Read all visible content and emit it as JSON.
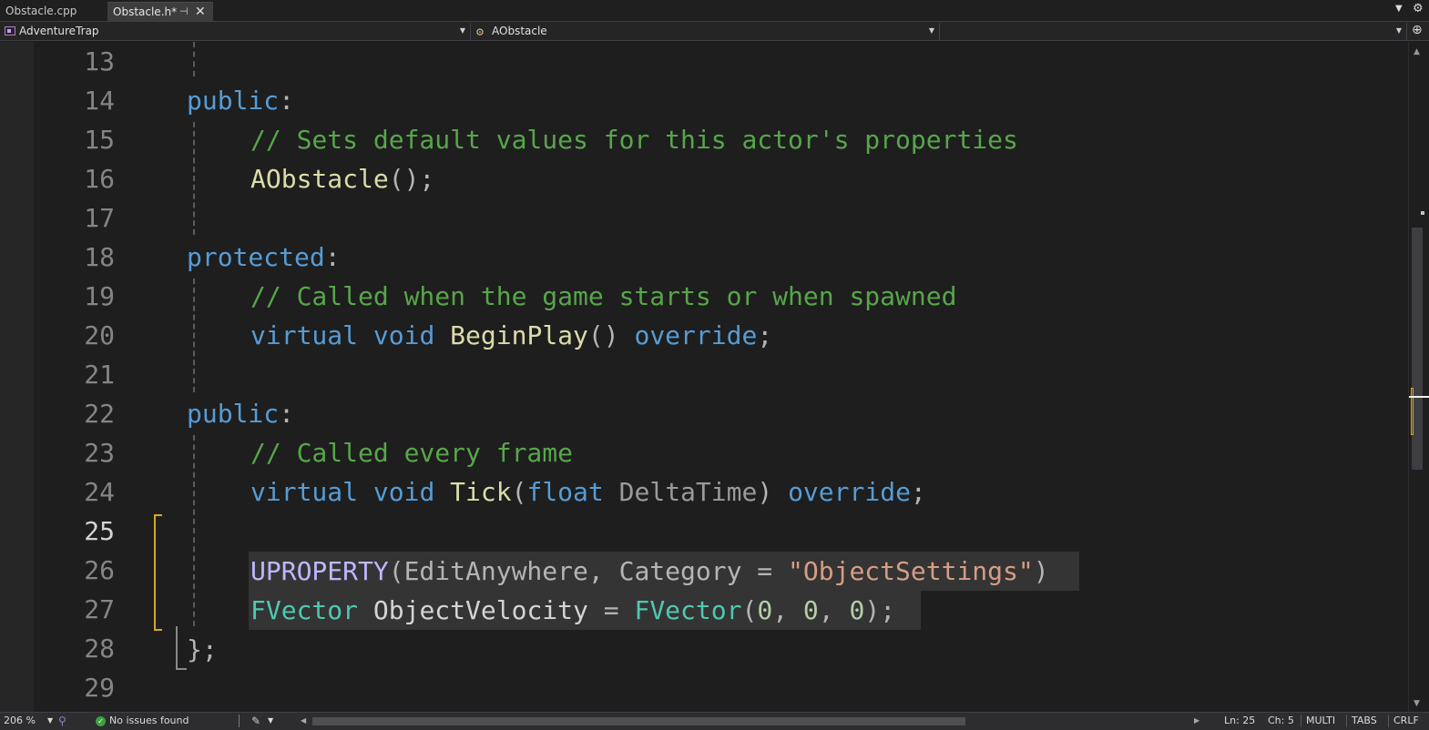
{
  "tabs": [
    {
      "label": "Obstacle.cpp",
      "active": false
    },
    {
      "label": "Obstacle.h*",
      "active": true,
      "pin_icon": "pin-icon",
      "close_icon": "close-icon"
    }
  ],
  "navbar": {
    "project": "AdventureTrap",
    "class_scope": "AObstacle",
    "member_scope": ""
  },
  "editor": {
    "current_line": 25,
    "lines": [
      {
        "num": "13",
        "text": ""
      },
      {
        "num": "14",
        "text": "public:"
      },
      {
        "num": "15",
        "text": "// Sets default values for this actor's properties"
      },
      {
        "num": "16",
        "text": "AObstacle();"
      },
      {
        "num": "17",
        "text": ""
      },
      {
        "num": "18",
        "text": "protected:"
      },
      {
        "num": "19",
        "text": "// Called when the game starts or when spawned"
      },
      {
        "num": "20",
        "text": "virtual void BeginPlay() override;"
      },
      {
        "num": "21",
        "text": ""
      },
      {
        "num": "22",
        "text": "public:"
      },
      {
        "num": "23",
        "text": "// Called every frame"
      },
      {
        "num": "24",
        "text": "virtual void Tick(float DeltaTime) override;"
      },
      {
        "num": "25",
        "text": ""
      },
      {
        "num": "26",
        "text": "UPROPERTY(EditAnywhere, Category = \"ObjectSettings\")"
      },
      {
        "num": "27",
        "text": "FVector ObjectVelocity = FVector(0, 0, 0);"
      },
      {
        "num": "28",
        "text": "};"
      },
      {
        "num": "29",
        "text": ""
      }
    ],
    "tokens": {
      "l14_kw": "public",
      "l14_p": ":",
      "l15_cm": "// Sets default values for this actor's properties",
      "l16_fn": "AObstacle",
      "l16_p": "();",
      "l18_kw": "protected",
      "l18_p": ":",
      "l19_cm": "// Called when the game starts or when spawned",
      "l20_kw1": "virtual",
      "l20_kw2": "void",
      "l20_fn": "BeginPlay",
      "l20_p": "()",
      "l20_kw3": "override",
      "l20_end": ";",
      "l22_kw": "public",
      "l22_p": ":",
      "l23_cm": "// Called every frame",
      "l24_kw1": "virtual",
      "l24_kw2": "void",
      "l24_fn": "Tick",
      "l24_p1": "(",
      "l24_kw3": "float",
      "l24_pm": "DeltaTime",
      "l24_p2": ")",
      "l24_kw4": "override",
      "l24_end": ";",
      "l26_mac": "UPROPERTY",
      "l26_p1": "(EditAnywhere, Category = ",
      "l26_st": "\"ObjectSettings\"",
      "l26_p2": ")",
      "l27_ty1": "FVector",
      "l27_var": "ObjectVelocity",
      "l27_eq": "=",
      "l27_ty2": "FVector",
      "l27_p1": "(",
      "l27_n1": "0",
      "l27_c1": ", ",
      "l27_n2": "0",
      "l27_c2": ", ",
      "l27_n3": "0",
      "l27_p2": ");",
      "l28": "};"
    }
  },
  "statusbar": {
    "zoom": "206 %",
    "issues": "No issues found",
    "line": "Ln: 25",
    "col": "Ch: 5",
    "selection_mode": "MULTI",
    "indent": "TABS",
    "line_ending": "CRLF"
  },
  "colors": {
    "keyword": "#569cd6",
    "comment": "#57a64a",
    "function": "#dcdcaa",
    "macro": "#beb7ff",
    "type": "#4ec9b0",
    "string": "#d69d85",
    "number": "#b5cea8",
    "change_marker": "#d7a820",
    "background": "#1e1e1e"
  }
}
